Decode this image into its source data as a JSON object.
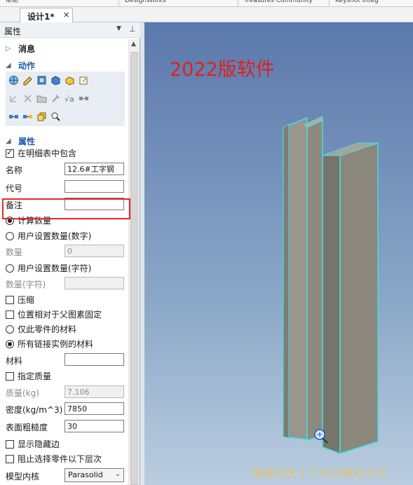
{
  "top_tabs": [
    "帮助",
    "DesignWorks",
    "Treasures Community",
    "Keyshot Integ"
  ],
  "document_tab": {
    "title": "设计1*",
    "close_icon": "close-icon"
  },
  "panel": {
    "title": "属性",
    "header_dropdown_icon": "chevron-down-icon",
    "header_pin_icon": "pin-icon",
    "sections": {
      "messages": "消息",
      "actions": "动作",
      "properties": "属性"
    },
    "include_in_bom": {
      "label": "在明细表中包含",
      "checked": true
    },
    "name": {
      "label": "名称",
      "value": "12.6#工字钢"
    },
    "code": {
      "label": "代号",
      "value": ""
    },
    "note": {
      "label": "备注",
      "value": ""
    },
    "calc_quantity": {
      "label": "计算数量",
      "selected": true
    },
    "user_quantity_number": {
      "label": "用户设置数量(数字)",
      "selected": false
    },
    "quantity": {
      "label": "数量",
      "value": "0"
    },
    "user_quantity_char": {
      "label": "用户设置数量(字符)",
      "selected": false
    },
    "quantity_char": {
      "label": "数量(字符)",
      "value": ""
    },
    "compress": {
      "label": "压缩",
      "checked": false
    },
    "fixed_relative": {
      "label": "位置相对于父图素固定",
      "checked": false
    },
    "only_part_material": {
      "label": "仅此零件的材料",
      "selected": false
    },
    "all_instances_material": {
      "label": "所有链接实例的材料",
      "selected": true
    },
    "material": {
      "label": "材料",
      "value": ""
    },
    "specify_mass": {
      "label": "指定质量",
      "checked": false
    },
    "mass": {
      "label": "质量(kg)",
      "value": "7.106"
    },
    "density": {
      "label": "密度(kg/m^3)",
      "value": "7850"
    },
    "roughness": {
      "label": "表面粗糙度",
      "value": "30"
    },
    "show_hidden_edges": {
      "label": "显示隐藏边",
      "checked": false
    },
    "block_select_below": {
      "label": "阻止选择零件以下层次",
      "checked": false
    },
    "model_kernel": {
      "label": "模型内核",
      "value": "Parasolid"
    }
  },
  "viewport": {
    "title": "2022版软件",
    "watermark": "咖速社区 | CAXA数码大方",
    "title_color": "#e01f1f",
    "background_top": "#5b78ac",
    "background_bottom": "#bacde0",
    "beam_color": "#8a877f",
    "edge_color": "#3fe0e0"
  },
  "colors": {
    "section_blue": "#1f5aa8",
    "highlight_red": "#e22a2a"
  }
}
